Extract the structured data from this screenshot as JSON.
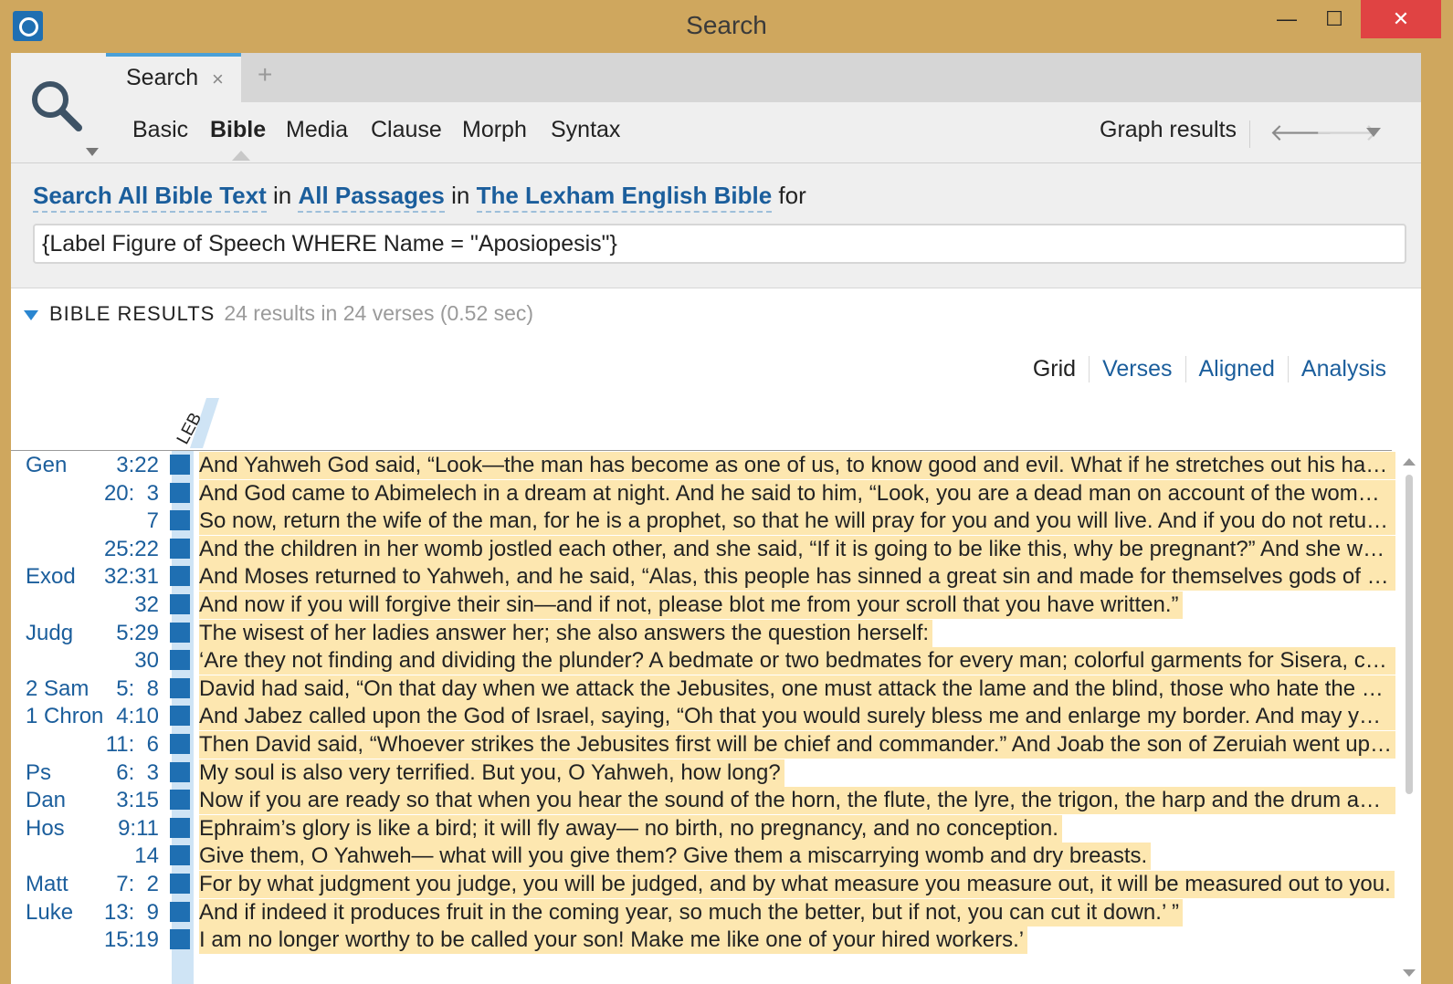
{
  "window": {
    "title": "Search",
    "minimize_glyph": "—",
    "maximize_glyph": "☐",
    "close_glyph": "✕"
  },
  "tabs": [
    {
      "label": "Search",
      "close_glyph": "×"
    }
  ],
  "new_tab_glyph": "+",
  "nav": {
    "tabs": [
      "Basic",
      "Bible",
      "Media",
      "Clause",
      "Morph",
      "Syntax"
    ],
    "active": "Bible",
    "graph_label": "Graph results",
    "back_glyph": "🡐",
    "forward_glyph": "🡒"
  },
  "query": {
    "scope_link": "Search All Bible Text",
    "in1": " in ",
    "passages_link": "All Passages",
    "in2": " in ",
    "resource_link": "The Lexham English Bible",
    "for": " for",
    "input_value": "{Label Figure of Speech WHERE Name = \"Aposiopesis\"}"
  },
  "results": {
    "header": "BIBLE RESULTS",
    "summary": "24 results in 24 verses (0.52 sec)",
    "views": [
      "Grid",
      "Verses",
      "Aligned",
      "Analysis"
    ],
    "active_view": "Grid",
    "column_label": "LEB",
    "rows": [
      {
        "book": "Gen",
        "ref": "3:22",
        "text": "And Yahweh God said, “Look—the man has become as one of us, to know good and evil. What if he stretches out his hand and takes also from the tree of life and eats, and lives forever?”"
      },
      {
        "book": "",
        "ref": "20:  3",
        "text": "And God came to Abimelech in a dream at night. And he said to him, “Look, you are a dead man on account of the woman whom you have taken, for she is married to a husband.”"
      },
      {
        "book": "",
        "ref": "7",
        "text": "So now, return the wife of the man, for he is a prophet, so that he will pray for you and you will live. And if you do not return her, know that you shall surely die."
      },
      {
        "book": "",
        "ref": "25:22",
        "text": "And the children in her womb jostled each other, and she said, “If it is going to be like this, why be pregnant?” And she went to inquire of Yahweh."
      },
      {
        "book": "Exod",
        "ref": "32:31",
        "text": "And Moses returned to Yahweh, and he said, “Alas, this people has sinned a great sin and made for themselves gods of gold."
      },
      {
        "book": "",
        "ref": "32",
        "text": "And now if you will forgive their sin—and if not, please blot me from your scroll that you have written.”"
      },
      {
        "book": "Judg",
        "ref": "5:29",
        "text": "The wisest of her ladies answer her; she also answers the question herself:"
      },
      {
        "book": "",
        "ref": "30",
        "text": "‘Are they not finding and dividing the plunder? A bedmate or two bedmates for every man; colorful garments for Sisera, colorful garments embroidered."
      },
      {
        "book": "2 Sam",
        "ref": "5:  8",
        "text": "David had said, “On that day when we attack the Jebusites, one must attack the lame and the blind, those who hate the soul of David, through the water shaft.”"
      },
      {
        "book": "1 Chron",
        "ref": "4:10",
        "text": "And Jabez called upon the God of Israel, saying, “Oh that you would surely bless me and enlarge my border. And may your hand be with me."
      },
      {
        "book": "",
        "ref": "11:  6",
        "text": "Then David said, “Whoever strikes the Jebusites first will be chief and commander.” And Joab the son of Zeruiah went up first, and so he became chief."
      },
      {
        "book": "Ps",
        "ref": "6:  3",
        "text": "My soul is also very terrified. But you, O Yahweh, how long?"
      },
      {
        "book": "Dan",
        "ref": "3:15",
        "text": "Now if you are ready so that when you hear the sound of the horn, the flute, the lyre, the trigon, the harp and the drum and the entire musical ensemble."
      },
      {
        "book": "Hos",
        "ref": "9:11",
        "text": "Ephraim’s glory is like a bird; it will fly away— no birth, no pregnancy, and no conception."
      },
      {
        "book": "",
        "ref": "14",
        "text": "Give them, O Yahweh— what will you give them? Give them a miscarrying womb and dry breasts."
      },
      {
        "book": "Matt",
        "ref": "7:  2",
        "text": "For by what judgment you judge, you will be judged, and by what measure you measure out, it will be measured out to you."
      },
      {
        "book": "Luke",
        "ref": "13:  9",
        "text": "And if indeed it produces fruit in the coming year, so much the better, but if not, you can cut it down.’ ”"
      },
      {
        "book": "",
        "ref": "15:19",
        "text": "I am no longer worthy to be called your son! Make me like one of your hired workers.’"
      }
    ]
  }
}
